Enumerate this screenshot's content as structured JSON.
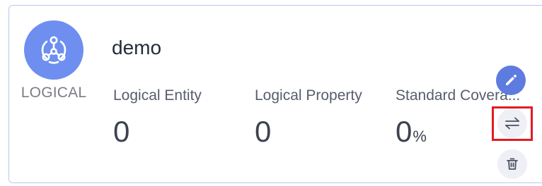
{
  "card": {
    "name": "demo",
    "model_type": "LOGICAL",
    "stats": [
      {
        "label": "Logical Entity",
        "value": "0",
        "unit": ""
      },
      {
        "label": "Logical Property",
        "value": "0",
        "unit": ""
      },
      {
        "label": "Standard Covera...",
        "value": "0",
        "unit": "%"
      }
    ]
  },
  "icons": {
    "model": "logical-model-icon",
    "edit": "pencil-icon",
    "switch": "swap-arrows-icon",
    "delete": "trash-icon"
  },
  "colors": {
    "accent": "#5e7ce0",
    "badge": "#6e8ff0",
    "card_border": "#b9c8ee",
    "highlight": "#e21b22"
  }
}
